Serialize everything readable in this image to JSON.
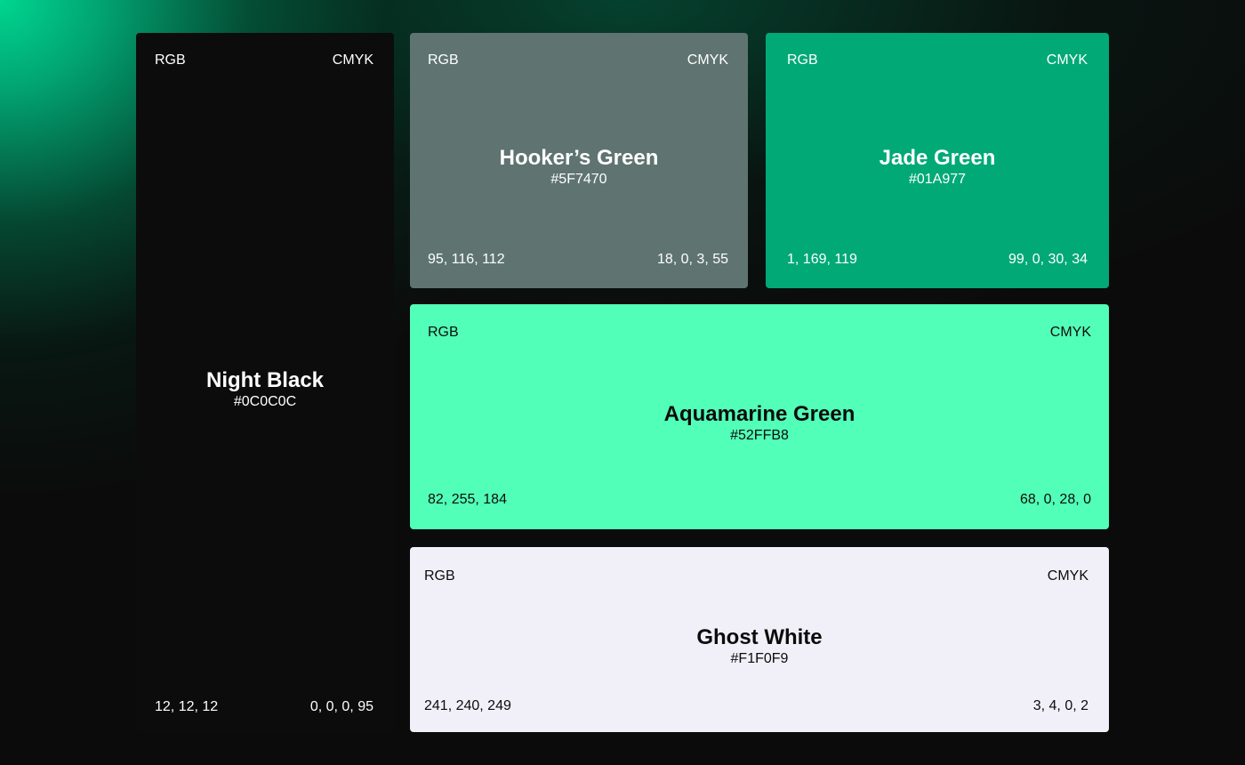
{
  "swatches": {
    "night_black": {
      "name": "Night Black",
      "hex": "#0C0C0C",
      "rgb_label": "RGB",
      "cmyk_label": "CMYK",
      "rgb": "12, 12, 12",
      "cmyk": "0, 0, 0, 95",
      "color": "#0C0C0C"
    },
    "hookers_green": {
      "name": "Hooker’s Green",
      "hex": "#5F7470",
      "rgb_label": "RGB",
      "cmyk_label": "CMYK",
      "rgb": "95, 116, 112",
      "cmyk": "18, 0, 3, 55",
      "color": "#5F7470"
    },
    "jade_green": {
      "name": "Jade Green",
      "hex": "#01A977",
      "rgb_label": "RGB",
      "cmyk_label": "CMYK",
      "rgb": "1, 169, 119",
      "cmyk": "99, 0, 30, 34",
      "color": "#01A977"
    },
    "aquamarine_green": {
      "name": "Aquamarine Green",
      "hex": "#52FFB8",
      "rgb_label": "RGB",
      "cmyk_label": "CMYK",
      "rgb": "82, 255, 184",
      "cmyk": "68, 0, 28, 0",
      "color": "#52FFB8"
    },
    "ghost_white": {
      "name": "Ghost White",
      "hex": "#F1F0F9",
      "rgb_label": "RGB",
      "cmyk_label": "CMYK",
      "rgb": "241, 240, 249",
      "cmyk": "3, 4, 0, 2",
      "color": "#F1F0F9"
    }
  }
}
